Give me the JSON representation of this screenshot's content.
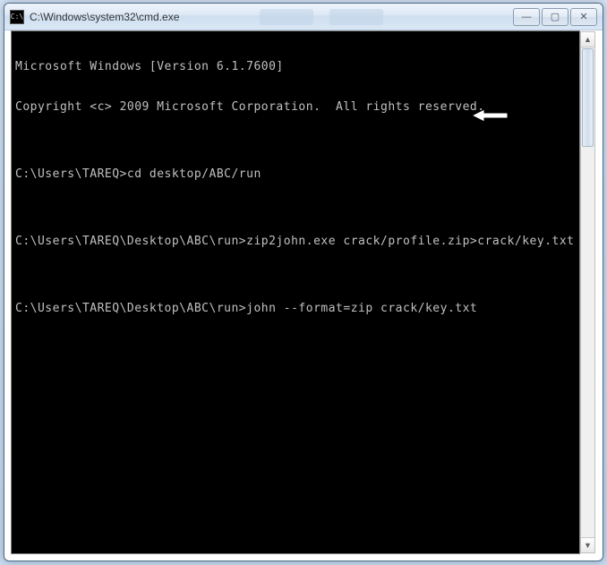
{
  "window": {
    "title": "C:\\Windows\\system32\\cmd.exe",
    "icon_label": "C:\\"
  },
  "controls": {
    "minimize": "—",
    "maximize": "▢",
    "close": "✕"
  },
  "console": {
    "lines": [
      "Microsoft Windows [Version 6.1.7600]",
      "Copyright <c> 2009 Microsoft Corporation.  All rights reserved.",
      "",
      "C:\\Users\\TAREQ>cd desktop/ABC/run",
      "",
      "C:\\Users\\TAREQ\\Desktop\\ABC\\run>zip2john.exe crack/profile.zip>crack/key.txt",
      "",
      "C:\\Users\\TAREQ\\Desktop\\ABC\\run>john --format=zip crack/key.txt"
    ]
  },
  "scrollbar": {
    "up": "▲",
    "down": "▼"
  }
}
